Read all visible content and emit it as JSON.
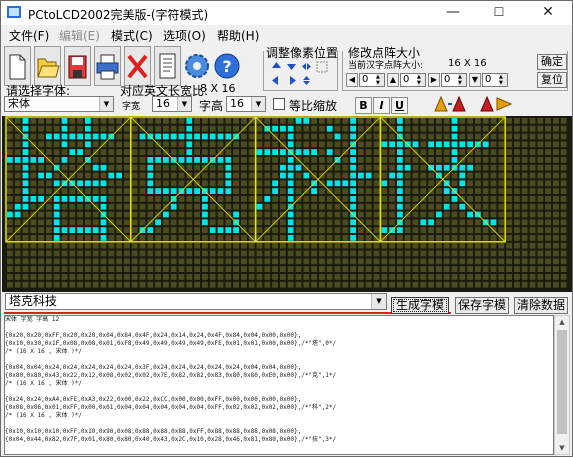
{
  "window": {
    "title": "PCtoLCD2002完美版-(字符模式)",
    "controls": {
      "minimize": "—",
      "maximize": "☐",
      "close": "✕"
    }
  },
  "menu": {
    "items": [
      {
        "label": "文件(F)",
        "disabled": false
      },
      {
        "label": "编辑(E)",
        "disabled": true
      },
      {
        "label": "模式(C)",
        "disabled": false
      },
      {
        "label": "选项(O)",
        "disabled": false
      },
      {
        "label": "帮助(H)",
        "disabled": false
      }
    ]
  },
  "toolbar": {
    "buttons": [
      "new-icon",
      "open-icon",
      "save-icon",
      "print-icon",
      "delete-icon",
      "document-icon",
      "settings-gear-icon",
      "help-icon"
    ],
    "pixel_group_title": "调整像素位置",
    "resize_group_title": "修改点阵大小",
    "current_char_size_label": "当前汉字点阵大小:",
    "current_size_value": "16 X 16",
    "confirm_label": "确定",
    "restore_label": "复位",
    "spinners": [
      "0",
      "0",
      "0",
      "0"
    ]
  },
  "font": {
    "choose_label": "请选择字体:",
    "font_value": "宋体",
    "ascii_width_label": "对应英文长宽比:",
    "ascii_width_value": "8 X 16",
    "char_width_label": "字宽",
    "char_width_value": "16",
    "char_height_label": "字高",
    "char_height_value": "16",
    "proportional_label": "等比缩放",
    "bold_label": "B",
    "italic_label": "I",
    "underline_label": "U"
  },
  "editor": {
    "text_value": "塔克科技",
    "generate_label": "生成字模",
    "save_label": "保存字模",
    "clear_label": "清除数据"
  },
  "output": {
    "lines": [
      "宋体 字宽 字高 12",
      "",
      "{0x20,0x20,0xFF,0x20,0x20,0x04,0x84,0x4F,0x24,0x14,0x24,0x4F,0x84,0x04,0x00,0x00},",
      "{0x10,0x30,0x1F,0x08,0x08,0x01,0xF8,0x49,0x49,0x49,0x49,0xFE,0x01,0x01,0x00,0x00},/*\"塔\",0*/",
      "/* (16 X 16 , 宋体 )*/",
      "",
      "{0x04,0x04,0x24,0x24,0x24,0x24,0x24,0x3F,0x24,0x24,0x24,0x24,0x24,0x04,0x04,0x00},",
      "{0x80,0x80,0x43,0x22,0x12,0x08,0x02,0x02,0x7E,0x82,0x82,0x83,0x80,0x80,0xE0,0x00},/*\"克\",1*/",
      "/* (16 X 16 , 宋体 )*/",
      "",
      "{0x24,0x24,0xA4,0xFE,0xA3,0x22,0x00,0x22,0xCC,0x00,0x00,0xFF,0x00,0x00,0x00,0x00},",
      "{0x08,0x06,0x01,0xFF,0x00,0x01,0x04,0x04,0x04,0x04,0x04,0xFF,0x02,0x02,0x02,0x00},/*\"科\",2*/",
      "/* (16 X 16 , 宋体 )*/",
      "",
      "{0x10,0x10,0x10,0xFF,0x10,0x90,0x08,0x88,0x88,0x88,0xFF,0x88,0x88,0x88,0x08,0x00},",
      "{0x04,0x44,0x82,0x7F,0x01,0x80,0x80,0x40,0x43,0x2C,0x10,0x28,0x46,0x81,0x80,0x00},/*\"技\",3*/"
    ]
  },
  "glyphs": [
    {
      "char": "塔",
      "rows": [
        "0010000100100000",
        "0010000100100000",
        "0010011111111100",
        "0010000100100000",
        "0010000011000000",
        "1111100100100000",
        "0010001000011000",
        "0010110000000110",
        "0010001111111000",
        "0010000000000000",
        "0011101111111000",
        "0110001000001000",
        "1100001000001000",
        "0000001000001000",
        "0000001111111000",
        "0000001000001000"
      ]
    },
    {
      "char": "克",
      "rows": [
        "0000000100000000",
        "0000000100000000",
        "0111111111111100",
        "0000000100000000",
        "0000000100000000",
        "0011111111111000",
        "0010000000001000",
        "0010000000001000",
        "0010000000001000",
        "0011111111111000",
        "0000010001000000",
        "0000010001000000",
        "0000100001000100",
        "0001000001000100",
        "0110000000111100",
        "0000000000000000"
      ]
    },
    {
      "char": "科",
      "rows": [
        "0000011000001000",
        "0111100001001000",
        "0000100000101000",
        "0000100000001000",
        "1111111101001000",
        "0000100000101000",
        "0001110000001000",
        "0001101000001110",
        "0010100101111000",
        "0010100100001000",
        "0100100000001000",
        "1000100000001000",
        "0000100000001000",
        "0000100000001000",
        "0000100000001000",
        "0000100000001000"
      ]
    },
    {
      "char": "技",
      "rows": [
        "0010000001000000",
        "0010000001000000",
        "0010000001000000",
        "1111101111111100",
        "0010000001000000",
        "0010000001000000",
        "0011001111110000",
        "0110000100100000",
        "1010000010100000",
        "0010000011000000",
        "0010000001000000",
        "0010000010100000",
        "0010000100011000",
        "0010011000000110",
        "1110000000000000",
        "0000000000000000"
      ]
    }
  ],
  "colors": {
    "pixel_on": "#00e6e6",
    "pixel_off": "#4b4b1e",
    "grid_bg": "#1a1a10",
    "char_frame": "#e6e600",
    "accent_underline": "#e02020"
  }
}
